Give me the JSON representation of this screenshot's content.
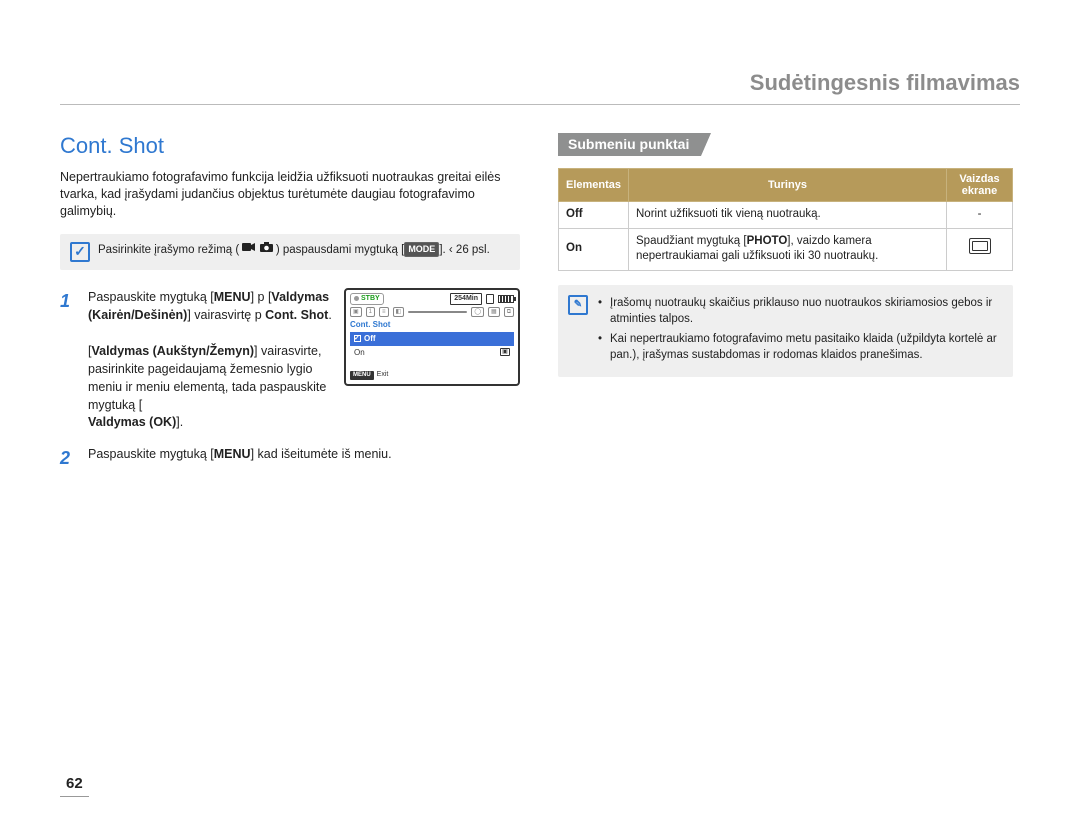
{
  "header": {
    "title": "Sudėtingesnis filmavimas"
  },
  "section": {
    "title": "Cont. Shot",
    "intro": "Nepertraukiamo fotografavimo funkcija leidžia užfiksuoti nuotraukas greitai eilės tvarka, kad įrašydami judančius objektus turėtumėte daugiau fotografavimo galimybių."
  },
  "note": {
    "text_pre": "Pasirinkite įrašymo režimą ( ",
    "text_mid": " ) paspausdami mygtuką [",
    "mode_label": "MODE",
    "text_post": "].  ‹ 26 psl."
  },
  "steps": {
    "s1": {
      "part1": "Paspauskite mygtuką [",
      "menu": "MENU",
      "part2": "] p [",
      "b1": "Valdymas (Kairėn/Dešinėn)",
      "part3": "] vairasvirtę  p ",
      "bold_cont": "Cont. Shot",
      "part4": "."
    },
    "s2": {
      "part1": "[",
      "b1": "Valdymas (Aukštyn/Žemyn)",
      "part2": "] vairasvirte, pasirinkite pageidaujamą žemesnio lygio meniu ir meniu elementą, tada paspauskite mygtuką [",
      "b2": "Valdymas (OK)",
      "part3": "]."
    },
    "s3": {
      "part1": "Paspauskite mygtuką [",
      "menu": "MENU",
      "part2": "] kad išeitumėte iš meniu."
    }
  },
  "camera_ui": {
    "stby": "STBY",
    "time": "254Min",
    "label": "Cont. Shot",
    "opt_off": "Off",
    "opt_on": "On",
    "menu_pill": "MENU",
    "exit": "Exit"
  },
  "submenu": {
    "heading": "Submeniu punktai",
    "th_element": "Elementas",
    "th_content": "Turinys",
    "th_screen1": "Vaizdas",
    "th_screen2": "ekrane",
    "rows": [
      {
        "el": "Off",
        "txt": "Norint užfiksuoti tik vieną nuotrauką.",
        "scr": "-"
      },
      {
        "el": "On",
        "txt_pre": "Spaudžiant mygtuką [",
        "photo": "PHOTO",
        "txt_post": "], vaizdo kamera nepertraukiamai gali užfiksuoti iki 30 nuotraukų."
      }
    ]
  },
  "info": {
    "li1": "Įrašomų nuotraukų skaičius priklauso nuo nuotraukos skiriamosios gebos ir atminties talpos.",
    "li2": "Kai nepertraukiamo fotografavimo metu pasitaiko klaida (užpildyta kortelė ar pan.), įrašymas sustabdomas ir rodomas klaidos pranešimas."
  },
  "page_number": "62"
}
